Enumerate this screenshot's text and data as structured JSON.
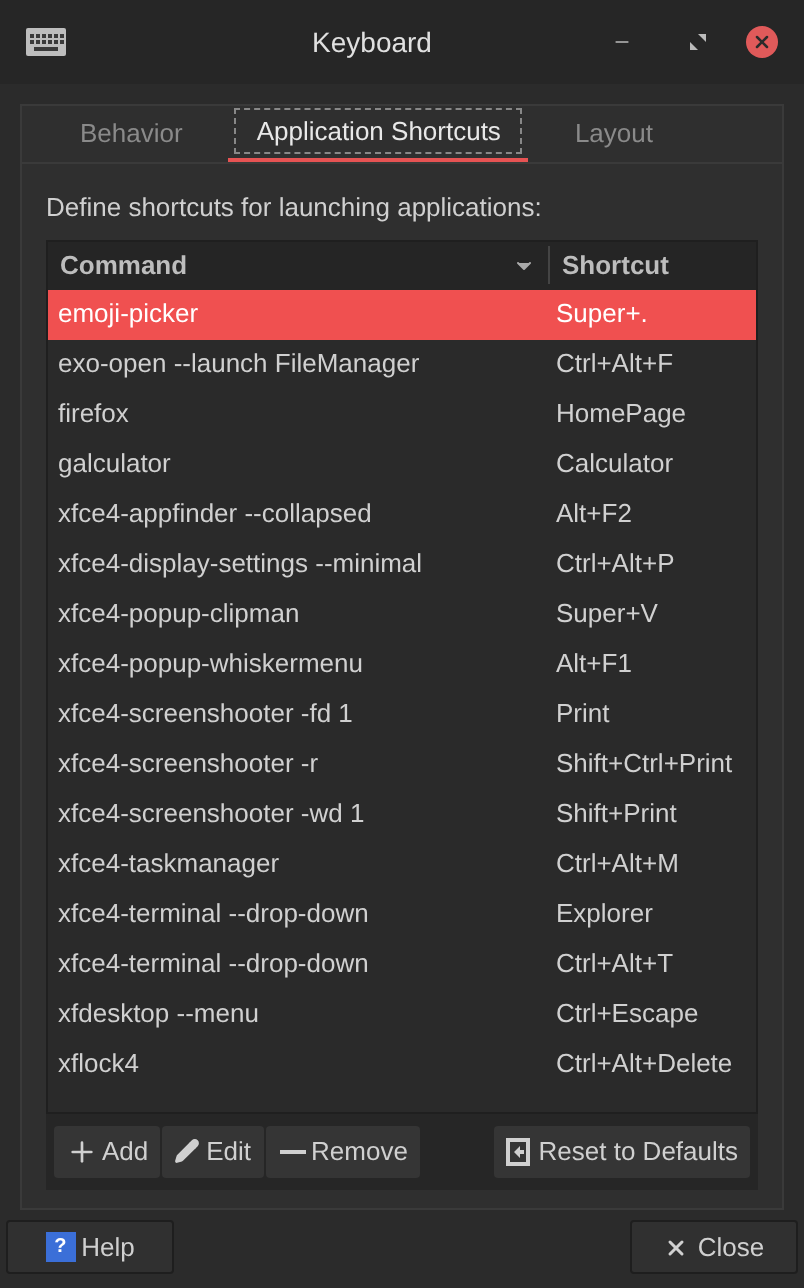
{
  "window": {
    "title": "Keyboard"
  },
  "tabs": [
    {
      "label": "Behavior",
      "selected": false
    },
    {
      "label": "Application Shortcuts",
      "selected": true
    },
    {
      "label": "Layout",
      "selected": false
    }
  ],
  "description": "Define shortcuts for launching applications:",
  "table": {
    "columns": [
      "Command",
      "Shortcut"
    ],
    "rows": [
      {
        "command": "emoji-picker",
        "shortcut": "Super+.",
        "selected": true
      },
      {
        "command": "exo-open --launch FileManager",
        "shortcut": "Ctrl+Alt+F",
        "selected": false
      },
      {
        "command": "firefox",
        "shortcut": "HomePage",
        "selected": false
      },
      {
        "command": "galculator",
        "shortcut": "Calculator",
        "selected": false
      },
      {
        "command": "xfce4-appfinder --collapsed",
        "shortcut": "Alt+F2",
        "selected": false
      },
      {
        "command": "xfce4-display-settings --minimal",
        "shortcut": "Ctrl+Alt+P",
        "selected": false
      },
      {
        "command": "xfce4-popup-clipman",
        "shortcut": "Super+V",
        "selected": false
      },
      {
        "command": "xfce4-popup-whiskermenu",
        "shortcut": "Alt+F1",
        "selected": false
      },
      {
        "command": "xfce4-screenshooter -fd 1",
        "shortcut": "Print",
        "selected": false
      },
      {
        "command": "xfce4-screenshooter -r",
        "shortcut": "Shift+Ctrl+Print",
        "selected": false
      },
      {
        "command": "xfce4-screenshooter -wd 1",
        "shortcut": "Shift+Print",
        "selected": false
      },
      {
        "command": "xfce4-taskmanager",
        "shortcut": "Ctrl+Alt+M",
        "selected": false
      },
      {
        "command": "xfce4-terminal --drop-down",
        "shortcut": "Explorer",
        "selected": false
      },
      {
        "command": "xfce4-terminal --drop-down",
        "shortcut": "Ctrl+Alt+T",
        "selected": false
      },
      {
        "command": "xfdesktop --menu",
        "shortcut": "Ctrl+Escape",
        "selected": false
      },
      {
        "command": "xflock4",
        "shortcut": "Ctrl+Alt+Delete",
        "selected": false
      }
    ]
  },
  "toolbar": {
    "add": "Add",
    "edit": "Edit",
    "remove": "Remove",
    "reset": "Reset to Defaults"
  },
  "footer": {
    "help_icon": "?",
    "help": "Help",
    "close": "Close"
  }
}
